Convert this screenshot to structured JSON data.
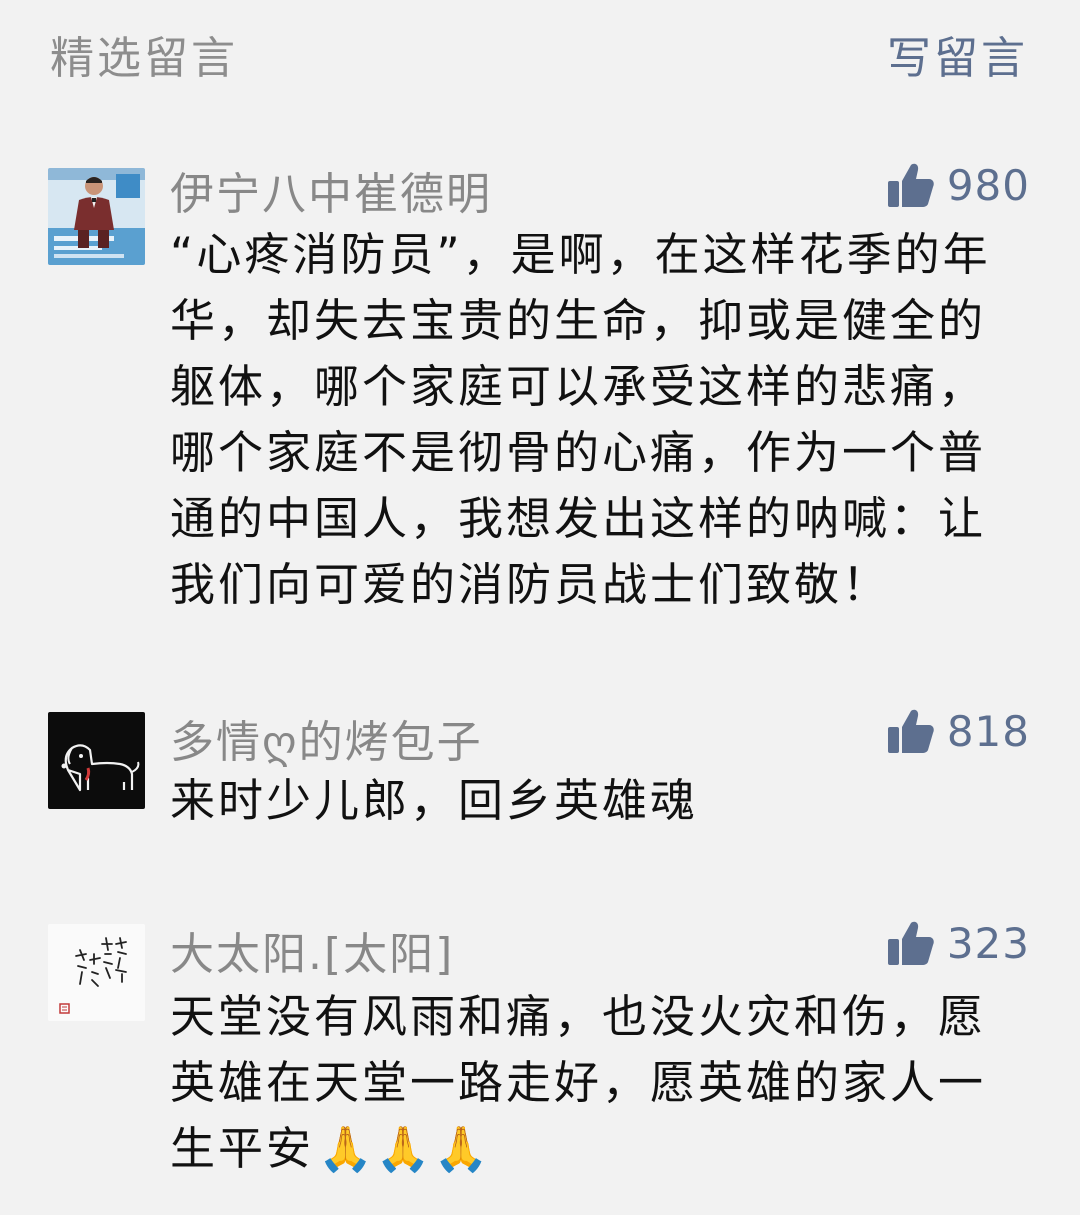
{
  "header": {
    "title": "精选留言",
    "write_label": "写留言"
  },
  "comments": [
    {
      "nickname": "伊宁八中崔德明",
      "likes": "980",
      "avatar_icon": "person-photo-avatar",
      "text": "“心疼消防员”，是啊，在这样花季的年华，却失去宝贵的生命，抑或是健全的躯体，哪个家庭可以承受这样的悲痛，哪个家庭不是彻骨的心痛，作为一个普通的中国人，我想发出这样的呐喊：让我们向可爱的消防员战士们致敬！"
    },
    {
      "nickname": "多情ღ的烤包子",
      "likes": "818",
      "avatar_icon": "dog-drawing-avatar",
      "text": "来时少儿郎，回乡英雄魂"
    },
    {
      "nickname": "大太阳.[太阳]",
      "likes": "323",
      "avatar_icon": "calligraphy-avatar",
      "avatar_lettering": "少一點套路 多一點真誠",
      "text": "天堂没有风雨和痛，也没火灾和伤，愿英雄在天堂一路走好，愿英雄的家人一生平安",
      "emoji": "🙏🙏🙏"
    }
  ],
  "colors": {
    "background": "#f2f2f2",
    "accent": "#5d6f8f",
    "nickname": "#888888",
    "body_text": "#111111"
  }
}
